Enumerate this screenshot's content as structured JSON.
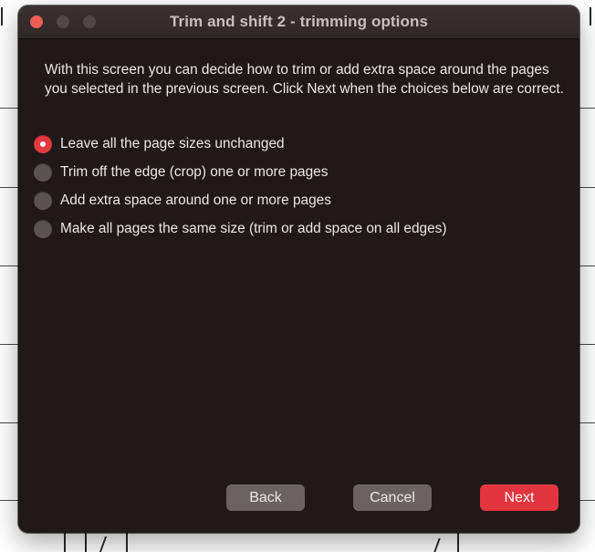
{
  "window": {
    "title": "Trim and shift 2 - trimming options",
    "traffic_lights": [
      "close",
      "minimize",
      "zoom"
    ]
  },
  "intro_text": "With this screen you can decide how to trim or add extra space around the pages you selected in the previous screen. Click Next when the choices below are correct.",
  "options": [
    {
      "label": "Leave all the page sizes unchanged",
      "selected": true
    },
    {
      "label": "Trim off the edge (crop) one or more pages",
      "selected": false
    },
    {
      "label": "Add extra space around one or more pages",
      "selected": false
    },
    {
      "label": "Make all pages the same size (trim or add space on all edges)",
      "selected": false
    }
  ],
  "buttons": {
    "back": "Back",
    "cancel": "Cancel",
    "next": "Next"
  },
  "colors": {
    "window_bg": "#201819",
    "accent": "#e3353d",
    "close_light": "#ed5e55"
  }
}
